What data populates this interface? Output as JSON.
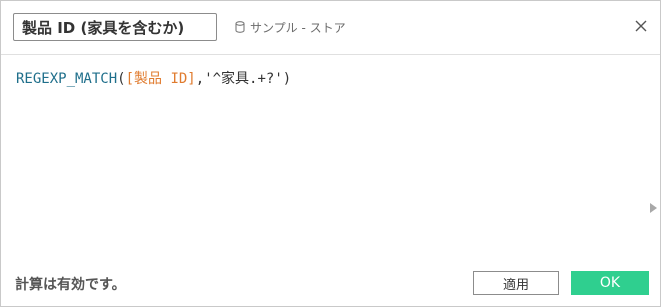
{
  "header": {
    "calc_name": "製品 ID (家具を含むか)",
    "datasource_icon": "database-icon",
    "datasource_label": "サンプル - ストア",
    "close_icon": "close-icon"
  },
  "editor": {
    "tokens": {
      "func": "REGEXP_MATCH",
      "open_paren": "(",
      "field": "[製品 ID]",
      "separator": ",",
      "pattern": "'^家具.+?'",
      "close_paren": ")"
    },
    "expander_icon": "triangle-right-icon"
  },
  "footer": {
    "status": "計算は有効です。",
    "apply_label": "適用",
    "ok_label": "OK"
  },
  "colors": {
    "function": "#1f6f8b",
    "field": "#e07b2e",
    "ok_button": "#2fcf8f"
  }
}
